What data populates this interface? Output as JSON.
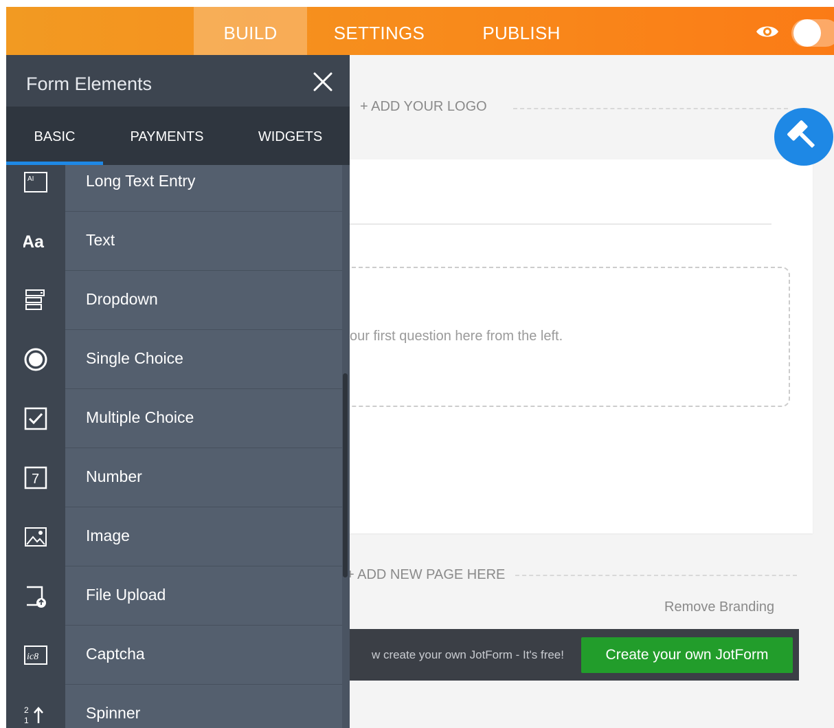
{
  "topbar": {
    "tabs": [
      {
        "label": "BUILD",
        "active": true
      },
      {
        "label": "SETTINGS",
        "active": false
      },
      {
        "label": "PUBLISH",
        "active": false
      }
    ],
    "preview_icon": "eye-icon",
    "toggle_state": "off"
  },
  "panel": {
    "title": "Form Elements",
    "close_icon": "close-icon",
    "tabs": [
      {
        "label": "BASIC",
        "active": true
      },
      {
        "label": "PAYMENTS",
        "active": false
      },
      {
        "label": "WIDGETS",
        "active": false
      }
    ],
    "elements": [
      {
        "label": "Long Text Entry",
        "icon": "textarea-icon"
      },
      {
        "label": "Text",
        "icon": "text-icon"
      },
      {
        "label": "Dropdown",
        "icon": "dropdown-icon"
      },
      {
        "label": "Single Choice",
        "icon": "radio-icon"
      },
      {
        "label": "Multiple Choice",
        "icon": "checkbox-icon"
      },
      {
        "label": "Number",
        "icon": "number-icon"
      },
      {
        "label": "Image",
        "icon": "image-icon"
      },
      {
        "label": "File Upload",
        "icon": "file-upload-icon"
      },
      {
        "label": "Captcha",
        "icon": "captcha-icon"
      },
      {
        "label": "Spinner",
        "icon": "spinner-icon"
      }
    ],
    "icon_text": {
      "text": "Aa",
      "number": "7",
      "captcha": "ic8",
      "textarea": "AI"
    }
  },
  "canvas": {
    "add_logo": "+ ADD YOUR LOGO",
    "drop_hint": "our first question here from the left.",
    "add_page": "+ ADD NEW PAGE HERE",
    "remove_branding": "Remove Branding",
    "promo_text": "w create your own JotForm - It's free!",
    "promo_button": "Create your own JotForm",
    "designer_icon": "paint-roller-icon"
  },
  "colors": {
    "topbar_orange": "#f88a1b",
    "panel_bg": "#545f6e",
    "accent_blue": "#1e88e5",
    "promo_green": "#229d2b"
  }
}
